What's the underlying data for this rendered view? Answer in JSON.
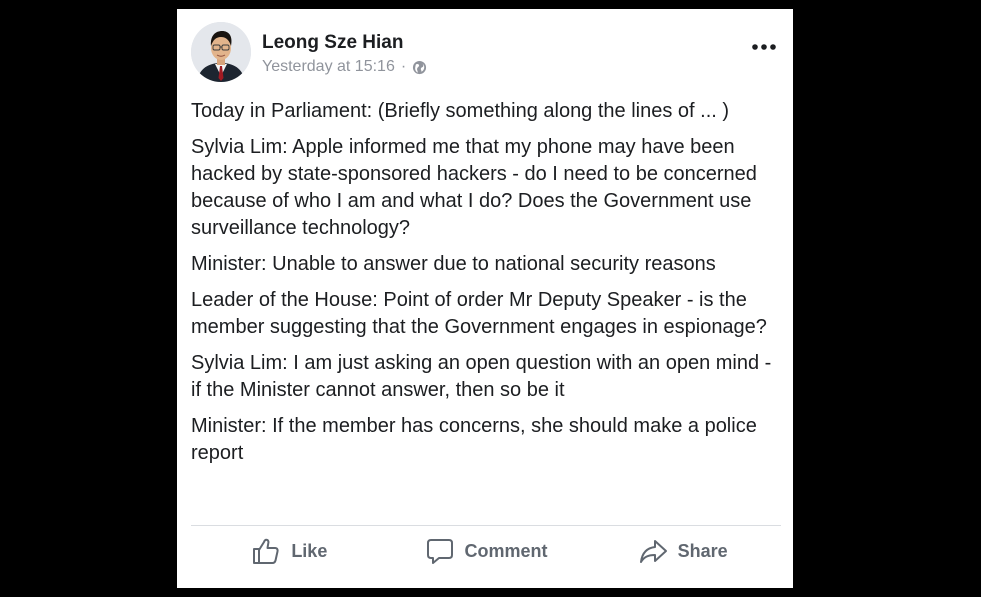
{
  "post": {
    "author": "Leong Sze Hian",
    "timestamp": "Yesterday at 15:16",
    "separator": "·",
    "privacy_icon": "globe-icon",
    "more_icon": "more-horizontal-icon",
    "avatar_icon": "profile-photo",
    "paragraphs": [
      "Today in Parliament: (Briefly something along the lines of ... )",
      "Sylvia Lim: Apple informed me that my phone may have been hacked by state-sponsored hackers - do I need to be concerned because of who I am and what I do? Does the Government use surveillance technology?",
      "Minister: Unable to answer due to national security reasons",
      "Leader of the House: Point of order Mr Deputy Speaker - is the member suggesting that the Government engages in espionage?",
      "Sylvia Lim: I am just asking an open question with an open mind - if the Minister cannot answer, then so be it",
      "Minister: If the member has concerns, she should make a police report"
    ]
  },
  "actions": {
    "like": {
      "label": "Like",
      "icon": "thumbs-up-icon"
    },
    "comment": {
      "label": "Comment",
      "icon": "comment-icon"
    },
    "share": {
      "label": "Share",
      "icon": "share-icon"
    }
  },
  "colors": {
    "background": "#000000",
    "card": "#ffffff",
    "text": "#1c1e21",
    "meta": "#90949c",
    "action": "#606770"
  }
}
